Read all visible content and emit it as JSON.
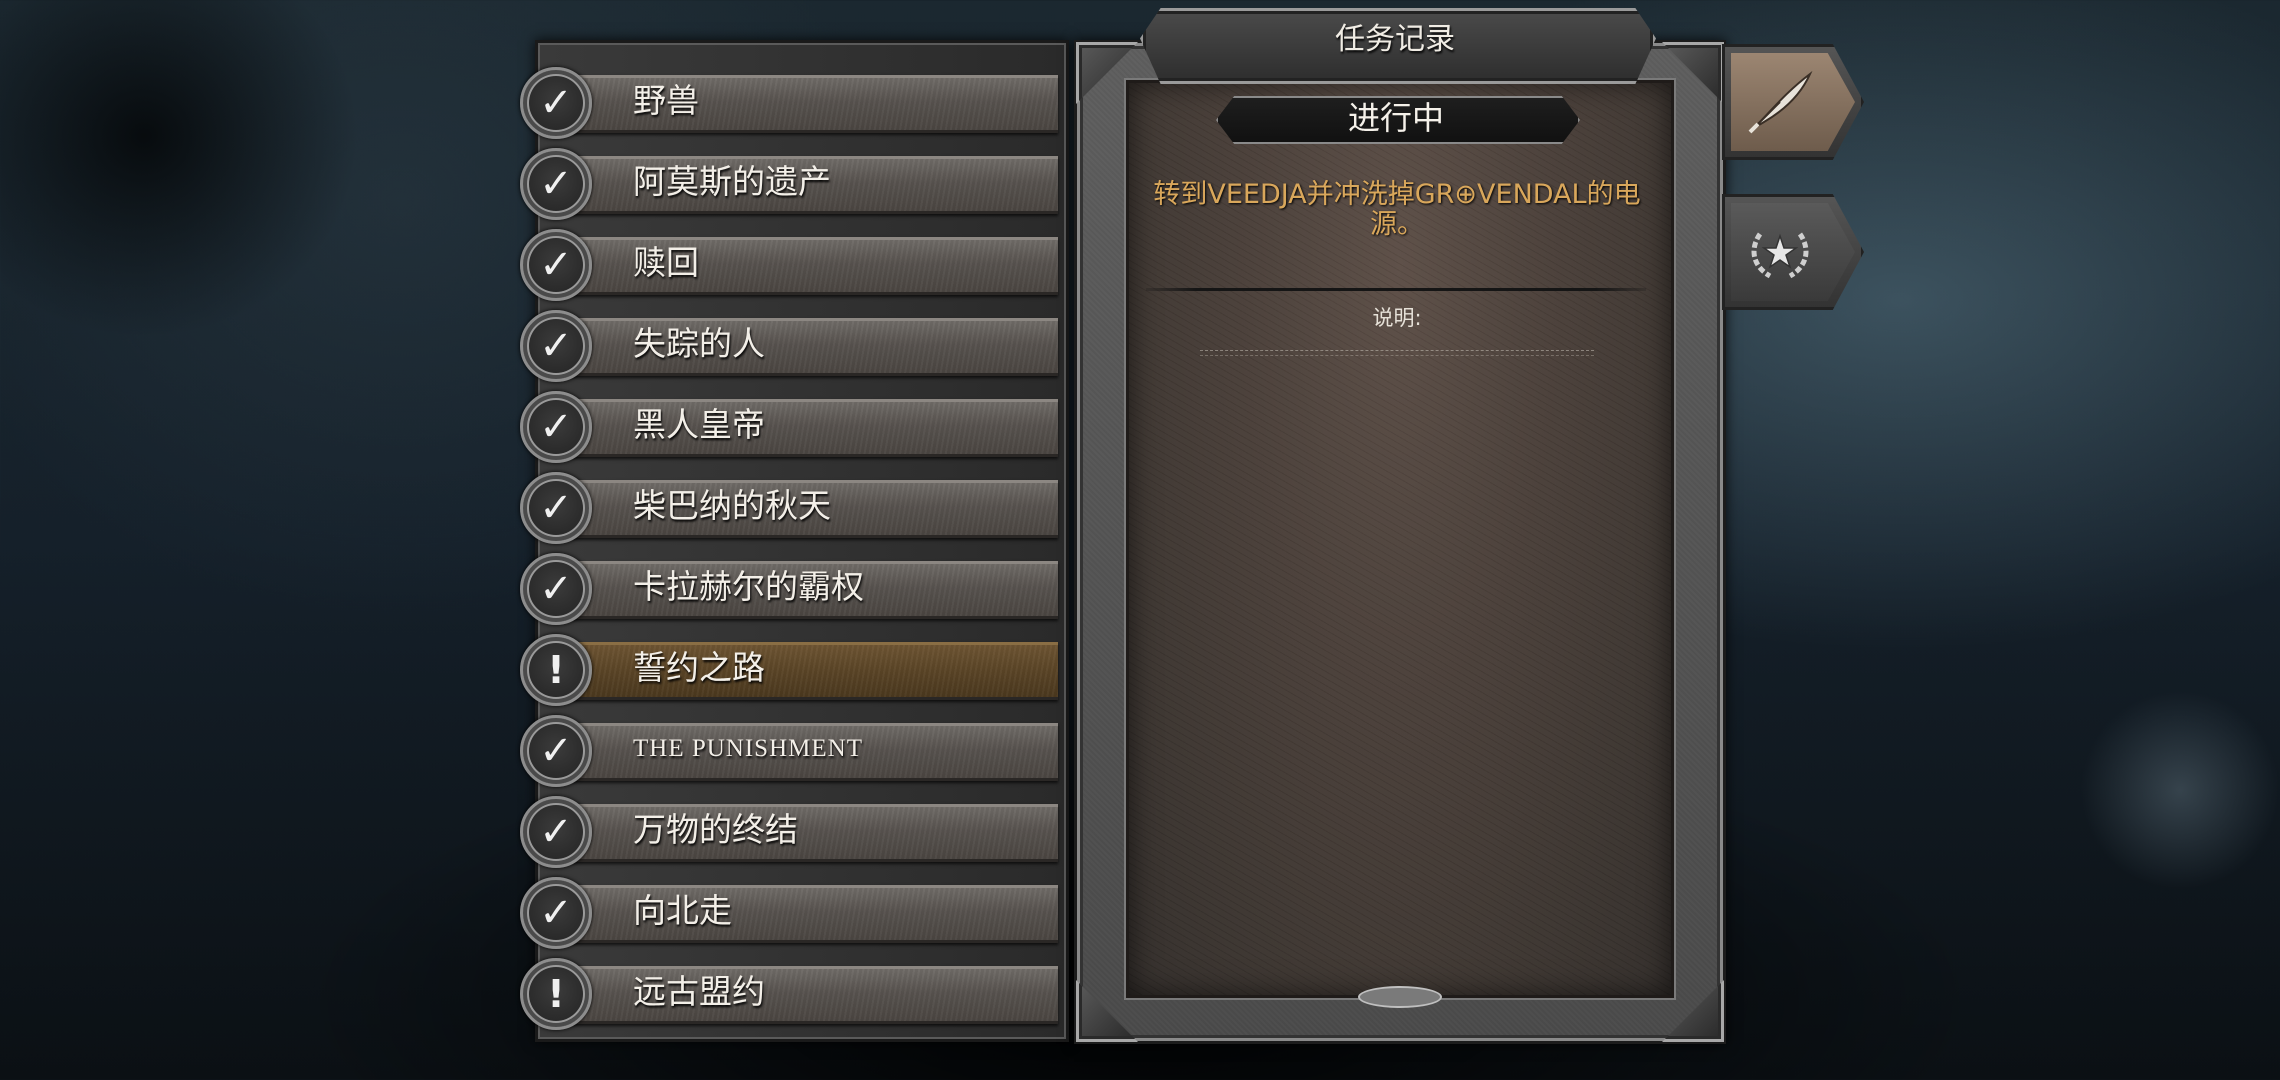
{
  "log": {
    "title": "任务记录",
    "status": "进行中",
    "objective": "转到VEEDJA并冲洗掉GR⊕VENDAL的电源。",
    "description_label": "说明:"
  },
  "quests": [
    {
      "name": "野兽",
      "state": "completed",
      "badge": "✓"
    },
    {
      "name": "阿莫斯的遗产",
      "state": "completed",
      "badge": "✓"
    },
    {
      "name": "赎回",
      "state": "completed",
      "badge": "✓"
    },
    {
      "name": "失踪的人",
      "state": "completed",
      "badge": "✓"
    },
    {
      "name": "黑人皇帝",
      "state": "completed",
      "badge": "✓"
    },
    {
      "name": "柴巴纳的秋天",
      "state": "completed",
      "badge": "✓"
    },
    {
      "name": "卡拉赫尔的霸权",
      "state": "completed",
      "badge": "✓"
    },
    {
      "name": "誓约之路",
      "state": "active",
      "badge": "!"
    },
    {
      "name": "THE PUNISHMENT",
      "state": "completed",
      "badge": "✓"
    },
    {
      "name": "万物的终结",
      "state": "completed",
      "badge": "✓"
    },
    {
      "name": "向北走",
      "state": "completed",
      "badge": "✓"
    },
    {
      "name": "远古盟约",
      "state": "in-progress",
      "badge": "!"
    }
  ],
  "tabs": [
    {
      "name": "quest-log",
      "icon": "quill-icon",
      "selected": true
    },
    {
      "name": "achievements",
      "icon": "laurel-star-icon",
      "selected": false
    }
  ],
  "colors": {
    "objective_text": "#d9a75b",
    "active_row": "#5a4426",
    "selected_tab": "#9c8672"
  }
}
